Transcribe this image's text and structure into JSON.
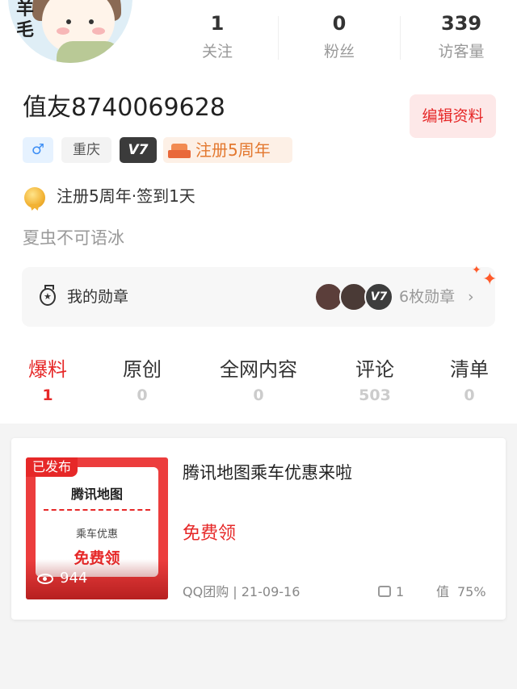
{
  "profile": {
    "avatar_text": "羊毛",
    "username": "值友8740069628",
    "edit_label": "编辑资料",
    "tags": {
      "gender_symbol": "♂",
      "city": "重庆",
      "level": "V7",
      "anniversary": "注册5周年"
    },
    "signin_text": "注册5周年·签到1天",
    "bio": "夏虫不可语冰"
  },
  "stats": [
    {
      "value": "1",
      "label": "关注"
    },
    {
      "value": "0",
      "label": "粉丝"
    },
    {
      "value": "339",
      "label": "访客量"
    }
  ],
  "badges": {
    "label": "我的勋章",
    "level_badge": "V7",
    "count_text": "6枚勋章",
    "chevron": "›"
  },
  "tabs": [
    {
      "label": "爆料",
      "count": "1"
    },
    {
      "label": "原创",
      "count": "0"
    },
    {
      "label": "全网内容",
      "count": "0"
    },
    {
      "label": "评论",
      "count": "503"
    },
    {
      "label": "清单",
      "count": "0"
    }
  ],
  "post": {
    "status": "已发布",
    "thumb_title": "腾讯地图",
    "thumb_subtitle": "乘车优惠",
    "thumb_cta": "免费领",
    "views": "944",
    "title": "腾讯地图乘车优惠来啦",
    "price": "免费领",
    "meta": "QQ团购 | 21-09-16",
    "comments": "1",
    "worth_icon": "值",
    "worth": "75%"
  },
  "colors": {
    "accent": "#e62828",
    "anniversary": "#e3782f",
    "gender": "#3d8ef5"
  }
}
